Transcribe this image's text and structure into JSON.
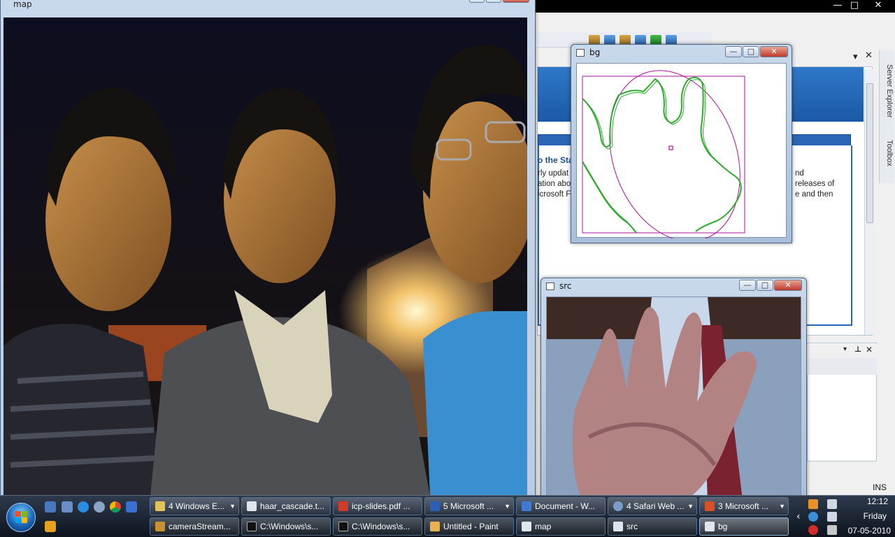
{
  "ide": {
    "doc_title": "o the Sta",
    "doc_lines_left": [
      "rly updat",
      "ation abo",
      "icrosoft F"
    ],
    "doc_lines_right": [
      "nd",
      "releases of",
      "e and then"
    ],
    "side_tabs": [
      "Server Explorer",
      "Toolbox"
    ],
    "status_ins": "INS"
  },
  "windows": {
    "map": {
      "title": "map"
    },
    "bg": {
      "title": "bg"
    },
    "src": {
      "title": "src"
    }
  },
  "window_buttons": {
    "minimize": "—",
    "maximize": "□",
    "close": "✕"
  },
  "taskbar": {
    "row1": [
      {
        "label": "4 Windows E...",
        "icon": "folder-icon",
        "dropdown": true
      },
      {
        "label": "haar_cascade.t...",
        "icon": "text-file-icon",
        "dropdown": false
      },
      {
        "label": "icp-slides.pdf ...",
        "icon": "pdf-icon",
        "dropdown": false
      },
      {
        "label": "5 Microsoft ...",
        "icon": "word-icon",
        "dropdown": true
      },
      {
        "label": "Document - W...",
        "icon": "wordpad-icon",
        "dropdown": false
      },
      {
        "label": "4 Safari Web ...",
        "icon": "safari-icon",
        "dropdown": true
      },
      {
        "label": "3 Microsoft ...",
        "icon": "office-icon",
        "dropdown": true
      }
    ],
    "row2": [
      {
        "label": "cameraStream...",
        "icon": "app-icon"
      },
      {
        "label": "C:\\Windows\\s...",
        "icon": "cmd-icon"
      },
      {
        "label": "C:\\Windows\\s...",
        "icon": "cmd-icon"
      },
      {
        "label": "Untitled - Paint",
        "icon": "paint-icon"
      },
      {
        "label": "map",
        "icon": "window-icon"
      },
      {
        "label": "src",
        "icon": "window-icon"
      },
      {
        "label": "bg",
        "icon": "window-icon"
      }
    ]
  },
  "clock": {
    "time": "12:12",
    "day": "Friday",
    "date": "07-05-2010"
  },
  "colors": {
    "contour": "#2eaa2e",
    "hull": "#b0109a"
  }
}
